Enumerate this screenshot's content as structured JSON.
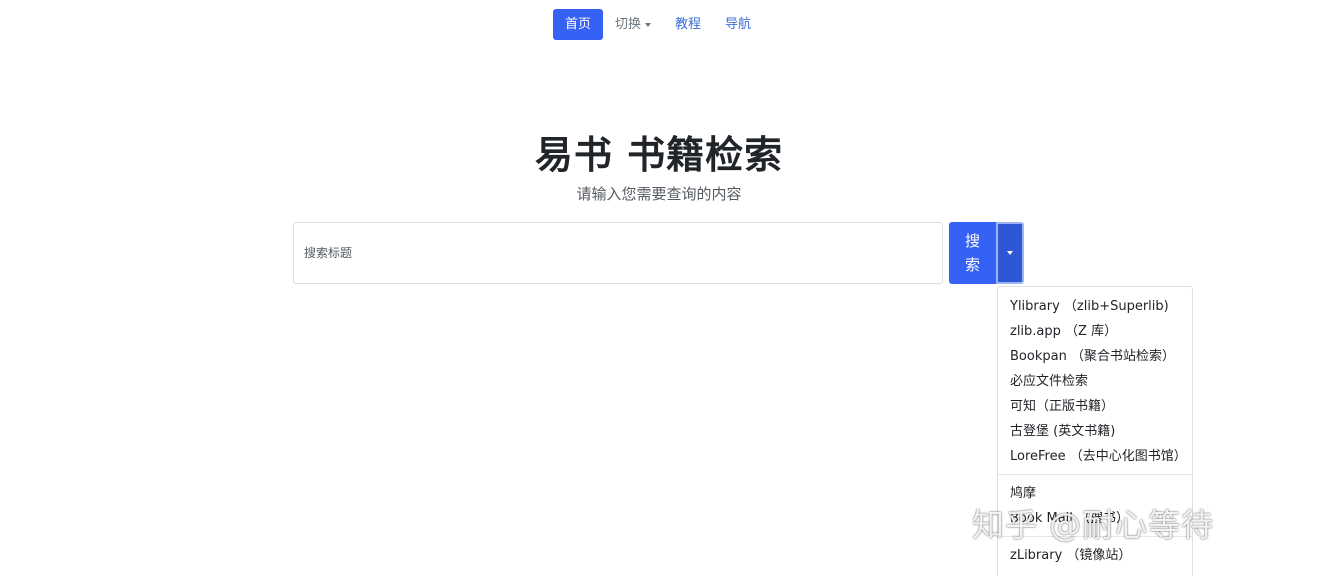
{
  "nav": {
    "home": "首页",
    "switch": "切换",
    "tutorial": "教程",
    "guide": "导航"
  },
  "header": {
    "title": "易书 书籍检索",
    "subtitle": "请输入您需要查询的内容"
  },
  "search": {
    "placeholder": "搜索标题",
    "value": "",
    "button_line1": "搜",
    "button_line2": "索"
  },
  "dropdown": {
    "items": [
      "Ylibrary （zlib+Superlib)",
      "zlib.app （Z 库）",
      "Bookpan （聚合书站检索）",
      "必应文件检索",
      "可知（正版书籍）",
      "古登堡 (英文书籍)",
      "LoreFree （去中心化图书馆）",
      "鸠摩",
      "Book Mall （搜书）",
      "zLibrary （镜像站）"
    ]
  },
  "watermark": "知乎 @耐心等待",
  "colors": {
    "accent": "#3561f5",
    "link": "#3b6fd8"
  }
}
